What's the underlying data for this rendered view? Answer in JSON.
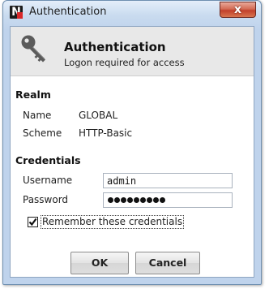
{
  "window": {
    "title": "Authentication",
    "app_icon_letter": "N",
    "close_symbol": "x"
  },
  "header": {
    "title": "Authentication",
    "subtitle": "Logon required for access",
    "icon": "key-icon"
  },
  "realm": {
    "section_title": "Realm",
    "name_label": "Name",
    "name_value": "GLOBAL",
    "scheme_label": "Scheme",
    "scheme_value": "HTTP-Basic"
  },
  "credentials": {
    "section_title": "Credentials",
    "username_label": "Username",
    "username_value": "admin",
    "password_label": "Password",
    "password_masked": "•••••••••",
    "remember_label": "Remember these credentials",
    "remember_checked": true
  },
  "buttons": {
    "ok_label": "OK",
    "cancel_label": "Cancel"
  },
  "colors": {
    "title_bar": "#c9dbef",
    "close_button": "#c2402a",
    "header_band": "#e8e8e8"
  }
}
